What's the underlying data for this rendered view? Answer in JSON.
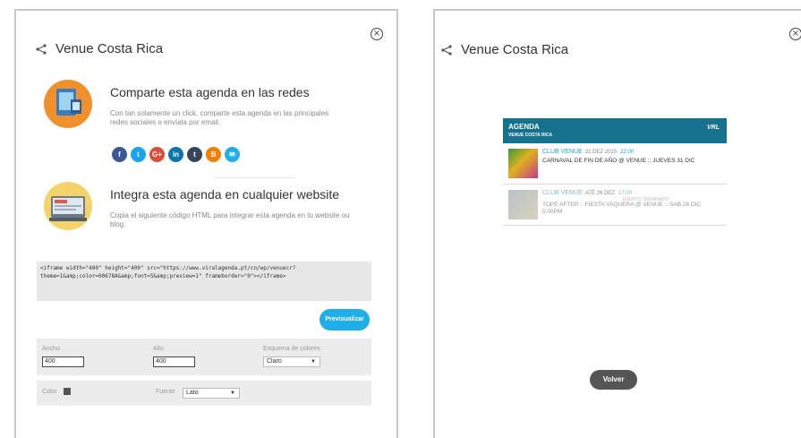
{
  "left_panel": {
    "title": "Venue Costa Rica",
    "close_glyph": "×",
    "share_section": {
      "title": "Comparte esta agenda en las redes",
      "description": "Con tan solamente un click, comparte esta agenda en las principales redes sociales o envíala por email."
    },
    "social_buttons": [
      {
        "name": "facebook",
        "glyph": "f",
        "color": "#3b5998"
      },
      {
        "name": "twitter",
        "glyph": "t",
        "color": "#1da1f2"
      },
      {
        "name": "google-plus",
        "glyph": "G+",
        "color": "#dd4b39"
      },
      {
        "name": "linkedin",
        "glyph": "in",
        "color": "#0e76a8"
      },
      {
        "name": "tumblr",
        "glyph": "t",
        "color": "#35465c"
      },
      {
        "name": "blogger",
        "glyph": "B",
        "color": "#f57d00"
      },
      {
        "name": "email",
        "glyph": "✉",
        "color": "#1faee6"
      }
    ],
    "embed_section": {
      "title": "Integra esta agenda en cualquier website",
      "description": "Copia el siguiente código HTML para integrar esta agenda en tu website ou blog."
    },
    "embed_code": "<iframe width=\"400\" height=\"400\" src=\"https://www.viralagenda.pt/cn/wp/venuecr?\ntheme=1&amp;color=00678A&amp;font=5&amp;preview=1\" frameborder=\"0\"></iframe>",
    "preview_button": "Previsualizar",
    "form": {
      "width_label": "Ancho",
      "width_value": "400",
      "height_label": "Alto",
      "height_value": "400",
      "scheme_label": "Esquema de colores",
      "scheme_value": "Claro",
      "color_label": "Color",
      "color_value": "#555555",
      "font_label": "Fuente",
      "font_value": "Lato"
    }
  },
  "right_panel": {
    "title": "Venue Costa Rica",
    "close_glyph": "×",
    "widget": {
      "header_title": "AGENDA",
      "header_subtitle": "VENUE COSTA RICA",
      "header_logo": "VRL",
      "events": [
        {
          "venue": "CLUB VENUE",
          "date": "31 DEZ 2015",
          "time": "22:00",
          "name": "CARNAVAL DE FIN DE AÑO @ VENUE :: JUEVES 31 DIC",
          "status": ""
        },
        {
          "venue": "CLUB VENUE",
          "date": "ATÉ 26 DEZ",
          "time": "17:00",
          "name": "TOPE AFTER :: FIESTA VAQUERA @ VENUE :: SAB 26 DIC 5:00PM",
          "status": "EVENTO TERMINADO"
        }
      ]
    },
    "back_button": "Volver"
  }
}
